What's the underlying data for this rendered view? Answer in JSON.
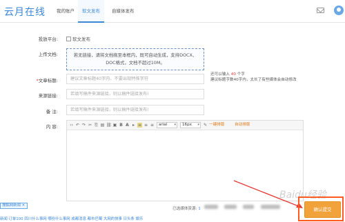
{
  "header": {
    "logo": "云月在线",
    "nav": [
      {
        "label": "我的账户"
      },
      {
        "label": "软文发布"
      },
      {
        "label": "自媒体发布"
      }
    ]
  },
  "form": {
    "platform_label": "投放平台:",
    "platform_value": "软文发布",
    "upload_label": "上传文档:",
    "upload_text_1": "若无链接，请将文档拖至本框内，既可自动生成，支持DOCX、",
    "upload_text_2": "DOC格式，文档不超过10M。",
    "title_req": "*",
    "title_label": "文章标题:",
    "title_placeholder": "建议文章标题40字内、不要出现特殊字符",
    "source_label": "来源链接:",
    "source_placeholder": "若填写稿件来源链接，则以稿件链接发布!",
    "remark_label": "备   注:",
    "remark_placeholder": "若填写稿件来源链接，则以稿件链接发布!",
    "content_label": "内   容:",
    "hint_prefix": "还可以输入",
    "hint_count": "40",
    "hint_suffix": "个字",
    "hint_line2": "建议标题字数40字内，太长了有些媒体会自动修改"
  },
  "editor": {
    "font_family": "arial",
    "font_size": "16px",
    "one_key_layout": "一键排版",
    "auto_layout": "自动排版"
  },
  "footer": {
    "selected_label": "已选媒体资源:",
    "selected_count": "1",
    "submit_label": "确认提交",
    "left_tag": "搜狐网新闻",
    "strip_text": "新闻      订单100      四川什么事网      哪份什么事网      成都消息      都市巴蜀      大网的快事      日头条      娱乐"
  },
  "watermark": "Baidu经验",
  "colors": {
    "accent": "#3a86d8",
    "submit": "#f2a23a",
    "highlight": "#ff5a1f"
  }
}
